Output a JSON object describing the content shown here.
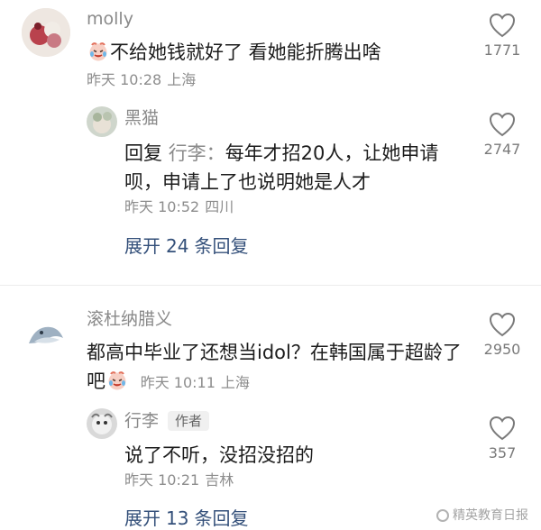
{
  "comments": [
    {
      "user": "molly",
      "text_before": "",
      "emoji": "crying-laughing-emoji",
      "text": "不给她钱就好了 看她能折腾出啥",
      "time": "昨天 10:28",
      "location": "上海",
      "likes": "1771",
      "replies": [
        {
          "user": "黑猫",
          "reply_prefix": "回复",
          "reply_to": "行李：",
          "text": "每年才招20人，让她申请呗，申请上了也说明她是人才",
          "time": "昨天 10:52",
          "location": "四川",
          "likes": "2747"
        }
      ],
      "expand_label": "展开",
      "expand_count": "24",
      "expand_suffix": "条回复"
    },
    {
      "user": "滚杜纳腊义",
      "text": "都高中毕业了还想当idol？在韩国属于超龄了吧",
      "emoji": "crying-laughing-emoji",
      "time": "昨天 10:11",
      "location": "上海",
      "likes": "2950",
      "replies": [
        {
          "user": "行李",
          "badge": "作者",
          "text": "说了不听，没招没招的",
          "time": "昨天 10:21",
          "location": "吉林",
          "likes": "357"
        }
      ],
      "expand_label": "展开",
      "expand_count": "13",
      "expand_suffix": "条回复"
    }
  ],
  "watermark": "精英教育日报",
  "colors": {
    "name": "#8a8a8a",
    "text": "#1c1c1c",
    "meta": "#8d8d8d",
    "expand": "#34507a",
    "divider": "#ececec"
  }
}
